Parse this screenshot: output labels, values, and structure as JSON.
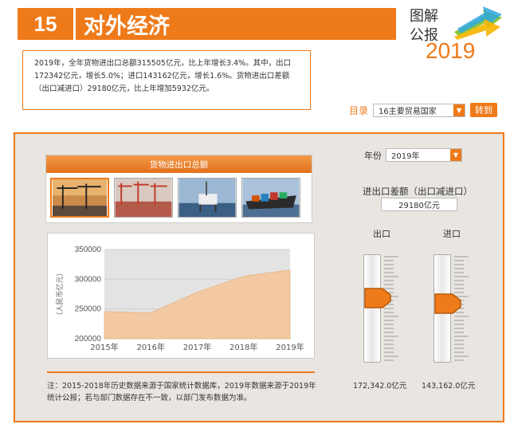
{
  "header": {
    "number": "15",
    "title": "对外经济",
    "logo": {
      "line1": "图解",
      "line2": "公报",
      "year": "2019"
    }
  },
  "summary": "2019年，全年货物进出口总额315505亿元，比上年增长3.4%。其中，出口172342亿元，增长5.0%；进口143162亿元，增长1.6%。货物进出口差额（出口减进口）29180亿元，比上年增加5932亿元。",
  "nav": {
    "label": "目录",
    "selected": "16主要贸易国家",
    "go_label": "转到"
  },
  "panel": {
    "image_box_title": "货物进出口总额",
    "thumbnails": [
      "port-cranes-sunset",
      "container-terminal",
      "oil-platform",
      "cargo-ship"
    ],
    "note": "注：2015-2018年历史数据来源于国家统计数据库，2019年数据来源于2019年统计公报；若与部门数据存在不一致，以部门发布数据为准。",
    "year_label": "年份",
    "year_selected": "2019年",
    "balance_label": "进出口差额（出口减进口）",
    "balance_value": "29180亿元",
    "export_label": "出口",
    "import_label": "进口",
    "export_value": "172,342.0亿元",
    "import_value": "143,162.0亿元",
    "export_level": 0.62,
    "import_level": 0.56
  },
  "chart_data": {
    "type": "area",
    "categories": [
      "2015年",
      "2016年",
      "2017年",
      "2018年",
      "2019年"
    ],
    "values": [
      245503,
      243386,
      278099,
      305008,
      315505
    ],
    "ylabel": "（人民币亿元）",
    "yticks": [
      "200000",
      "250000",
      "300000",
      "350000"
    ],
    "ylim": [
      200000,
      350000
    ],
    "grid": true,
    "colors": {
      "fill": "#f2c9a2",
      "plot_bg": "#e3e3e3"
    }
  },
  "colors": {
    "accent": "#ef7a1a"
  }
}
